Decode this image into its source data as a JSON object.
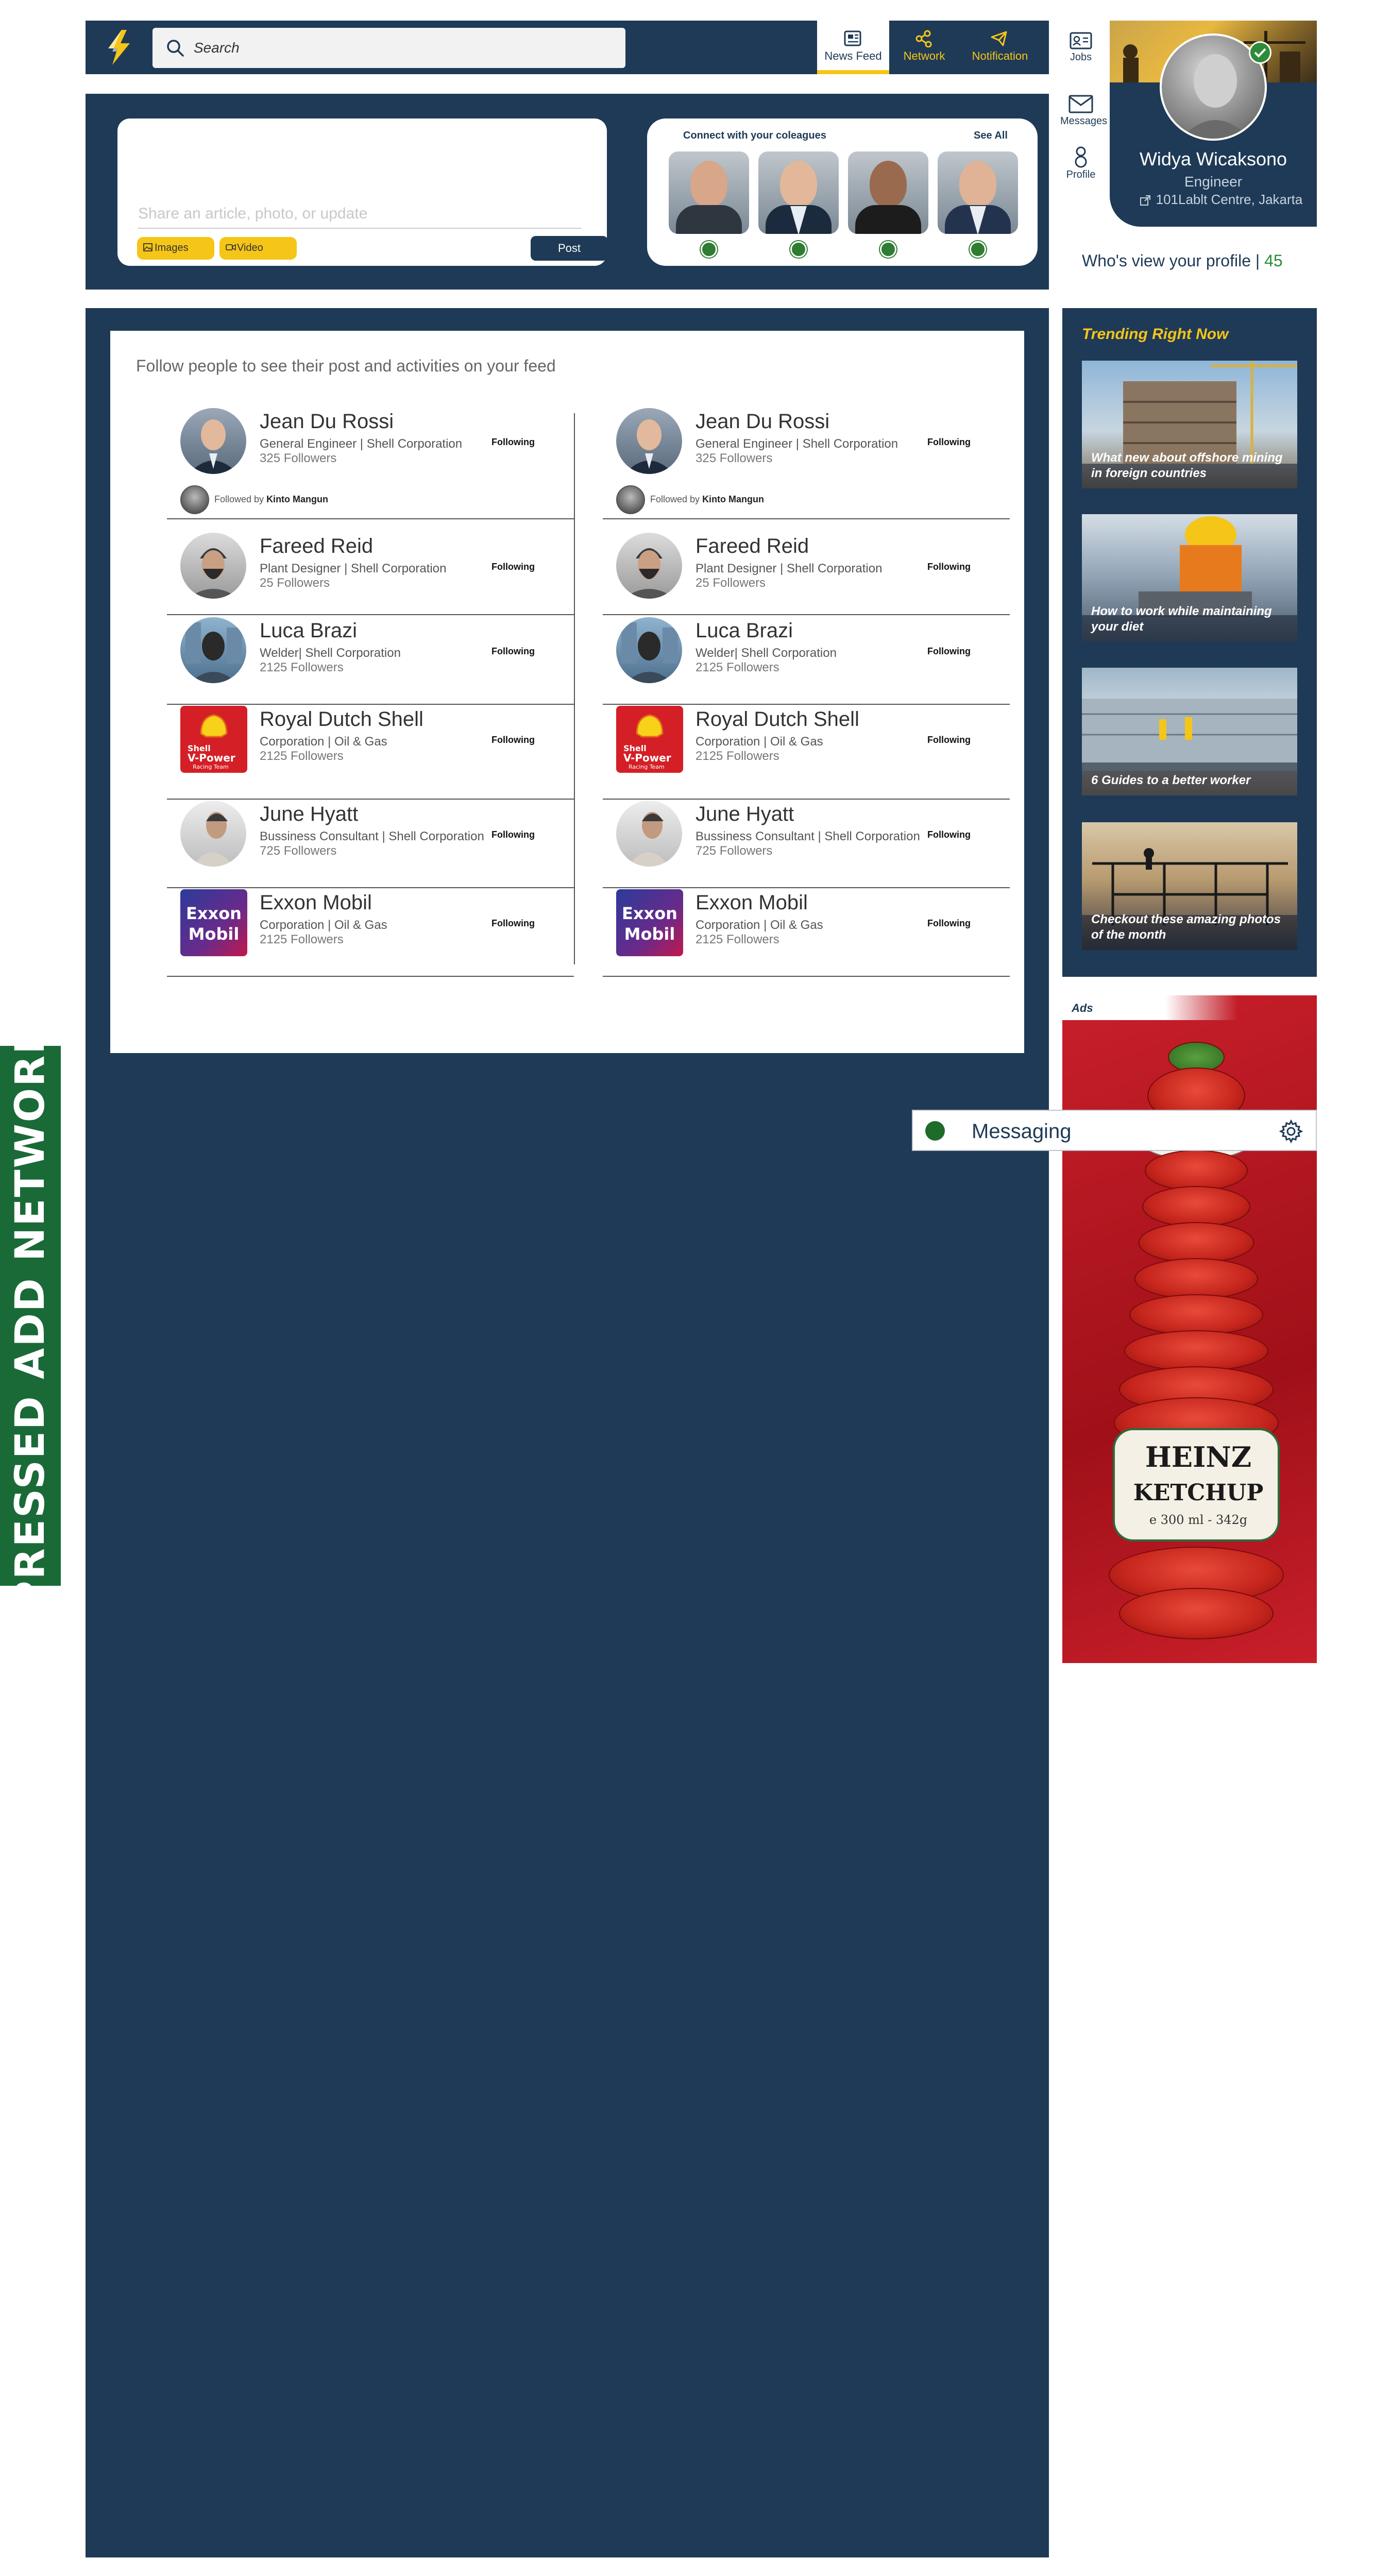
{
  "header": {
    "search_placeholder": "Search",
    "tabs": [
      {
        "label": "News Feed",
        "icon": "newspaper-icon",
        "active": true
      },
      {
        "label": "Network",
        "icon": "share-network-icon",
        "active": false
      },
      {
        "label": "Notification",
        "icon": "megaphone-icon",
        "active": false
      }
    ],
    "side_nav": [
      {
        "label": "Jobs",
        "icon": "jobs-icon"
      },
      {
        "label": "Messages",
        "icon": "envelope-icon"
      },
      {
        "label": "Profile",
        "icon": "person-icon"
      }
    ]
  },
  "profile": {
    "name": "Widya Wicaksono",
    "title": "Engineer",
    "location": "101Lablt Centre, Jakarta",
    "views_label": "Who's view your profile |",
    "views_count": "45"
  },
  "compose": {
    "placeholder": "Share an article, photo, or update",
    "images_label": "Images",
    "video_label": "Video",
    "post_label": "Post"
  },
  "connect": {
    "title": "Connect with your coleagues",
    "see_all": "See All"
  },
  "feed": {
    "heading": "Follow people to see their post and activities on your feed",
    "left": [
      {
        "name": "Jean Du Rossi",
        "role": "General Engineer | Shell Corporation",
        "followers": "325 Followers",
        "button": "Following",
        "followed_by_prefix": "Followed by",
        "followed_by_name": "Kinto Mangun"
      },
      {
        "name": "Fareed Reid",
        "role": "Plant Designer | Shell Corporation",
        "followers": "25 Followers",
        "button": "Following"
      },
      {
        "name": "Luca Brazi",
        "role": "Welder| Shell Corporation",
        "followers": "2125 Followers",
        "button": "Following"
      },
      {
        "name": "Royal Dutch Shell",
        "role": "Corporation | Oil & Gas",
        "followers": "2125 Followers",
        "button": "Following"
      },
      {
        "name": "June Hyatt",
        "role": "Bussiness Consultant | Shell Corporation",
        "followers": "725 Followers",
        "button": "Following"
      },
      {
        "name": "Exxon Mobil",
        "role": "Corporation | Oil & Gas",
        "followers": "2125 Followers",
        "button": "Following"
      }
    ],
    "right": [
      {
        "name": "Jean Du Rossi",
        "role": "General Engineer | Shell Corporation",
        "followers": "325 Followers",
        "button": "Following",
        "followed_by_prefix": "Followed by",
        "followed_by_name": "Kinto Mangun"
      },
      {
        "name": "Fareed Reid",
        "role": "Plant Designer | Shell Corporation",
        "followers": "25 Followers",
        "button": "Following"
      },
      {
        "name": "Luca Brazi",
        "role": "Welder| Shell Corporation",
        "followers": "2125 Followers",
        "button": "Following"
      },
      {
        "name": "Royal Dutch Shell",
        "role": "Corporation | Oil & Gas",
        "followers": "2125 Followers",
        "button": "Following"
      },
      {
        "name": "June Hyatt",
        "role": "Bussiness Consultant | Shell Corporation",
        "followers": "725 Followers",
        "button": "Following"
      },
      {
        "name": "Exxon Mobil",
        "role": "Corporation | Oil & Gas",
        "followers": "2125 Followers",
        "button": "Following"
      }
    ]
  },
  "trending": {
    "title": "Trending Right Now",
    "items": [
      {
        "caption": "What new about offshore mining in foreign countries"
      },
      {
        "caption": "How to work while maintaining your diet"
      },
      {
        "caption": "6 Guides to a better worker"
      },
      {
        "caption": "Checkout these amazing photos of the month"
      }
    ]
  },
  "ads": {
    "label": "Ads",
    "brand_text": "HEINZ",
    "product_text": "KETCHUP",
    "weight_text": "e 300 ml - 342g"
  },
  "messaging": {
    "title": "Messaging"
  },
  "left_banner": {
    "text": "PRESSED ADD NETWORK"
  },
  "brand_logos": {
    "shell_line1": "Shell",
    "shell_line2": "V-Power",
    "shell_line3": "Racing Team",
    "exxon_line1": "Exxon",
    "exxon_line2": "Mobil"
  },
  "colors": {
    "navy": "#1e3a56",
    "accent_yellow": "#f5c518",
    "success_green": "#2e8b3a",
    "banner_green": "#1a6a38"
  }
}
